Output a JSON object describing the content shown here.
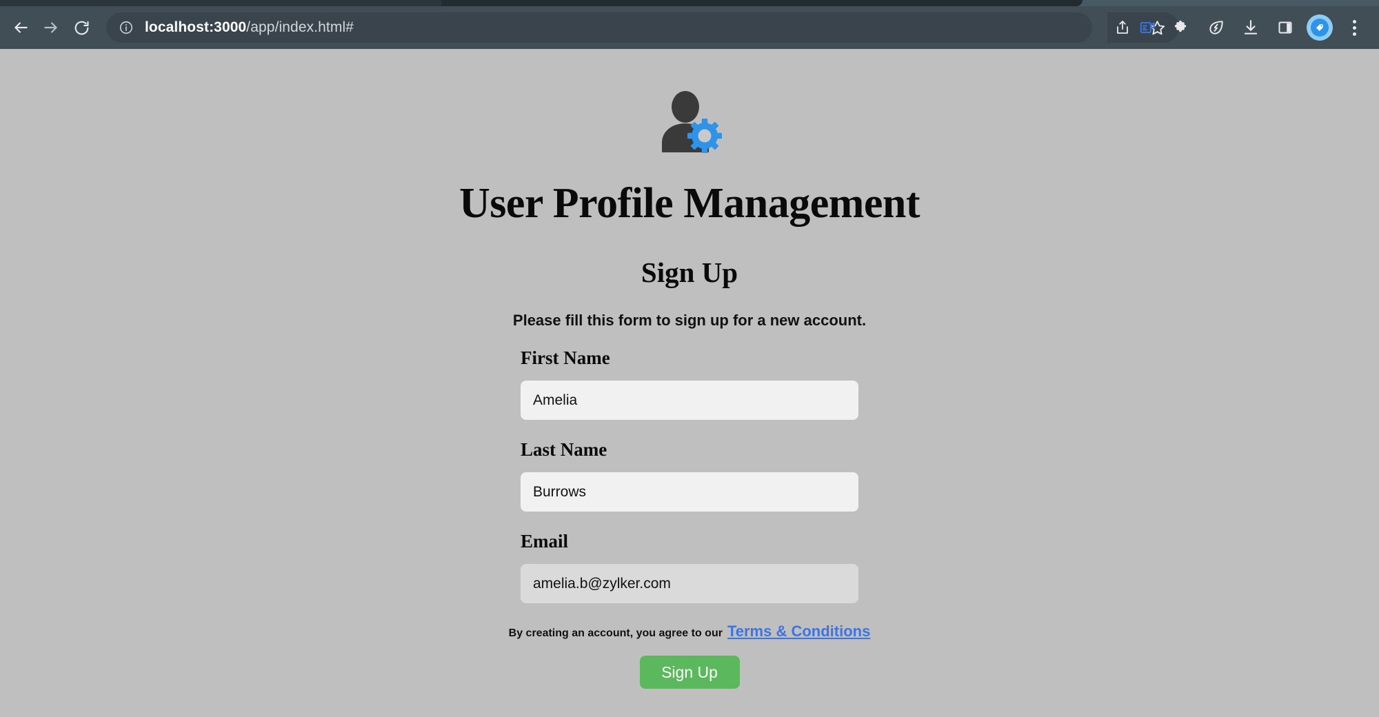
{
  "browser": {
    "nav": {
      "back_label": "Back",
      "forward_label": "Forward",
      "reload_label": "Reload"
    },
    "omnibox": {
      "host": "localhost:3000",
      "path": "/app/index.html#",
      "full_url": "localhost:3000/app/index.html#",
      "site_info_label": "View site information"
    },
    "actions": [
      {
        "name": "share-icon",
        "label": "Share"
      },
      {
        "name": "bookmark-star-icon",
        "label": "Bookmark this tab"
      },
      {
        "name": "screencast-icon",
        "label": "Screencast"
      },
      {
        "name": "extensions-puzzle-icon",
        "label": "Extensions"
      },
      {
        "name": "memory-saver-leaf-icon",
        "label": "Memory Saver"
      },
      {
        "name": "downloads-icon",
        "label": "Downloads"
      },
      {
        "name": "side-panel-icon",
        "label": "Side panel"
      },
      {
        "name": "profile-avatar",
        "label": "Profile"
      },
      {
        "name": "chrome-menu-icon",
        "label": "Customize and control"
      }
    ]
  },
  "page": {
    "brand_icon": "user-gear-icon",
    "title": "User Profile Management",
    "section_title": "Sign Up",
    "section_subtitle": "Please fill this form to sign up for a new account.",
    "fields": [
      {
        "name": "first-name",
        "label": "First Name",
        "value": "Amelia",
        "placeholder": "",
        "focused": false
      },
      {
        "name": "last-name",
        "label": "Last Name",
        "value": "Burrows",
        "placeholder": "",
        "focused": false
      },
      {
        "name": "email",
        "label": "Email",
        "value": "amelia.b@zylker.com",
        "placeholder": "",
        "focused": true
      }
    ],
    "terms": {
      "prefix": "By creating an account, you agree to our",
      "link": "Terms & Conditions"
    },
    "submit_label": "Sign Up",
    "colors": {
      "page_background": "#bfbfbf",
      "input_background": "#f1f1f1",
      "input_focus_background": "#dadada",
      "submit_green": "#5cb85c",
      "link_blue": "#3b74e8",
      "gear_blue": "#2f93e8",
      "silhouette_gray": "#3a3a3a",
      "toolbar_background": "#424e56"
    }
  }
}
